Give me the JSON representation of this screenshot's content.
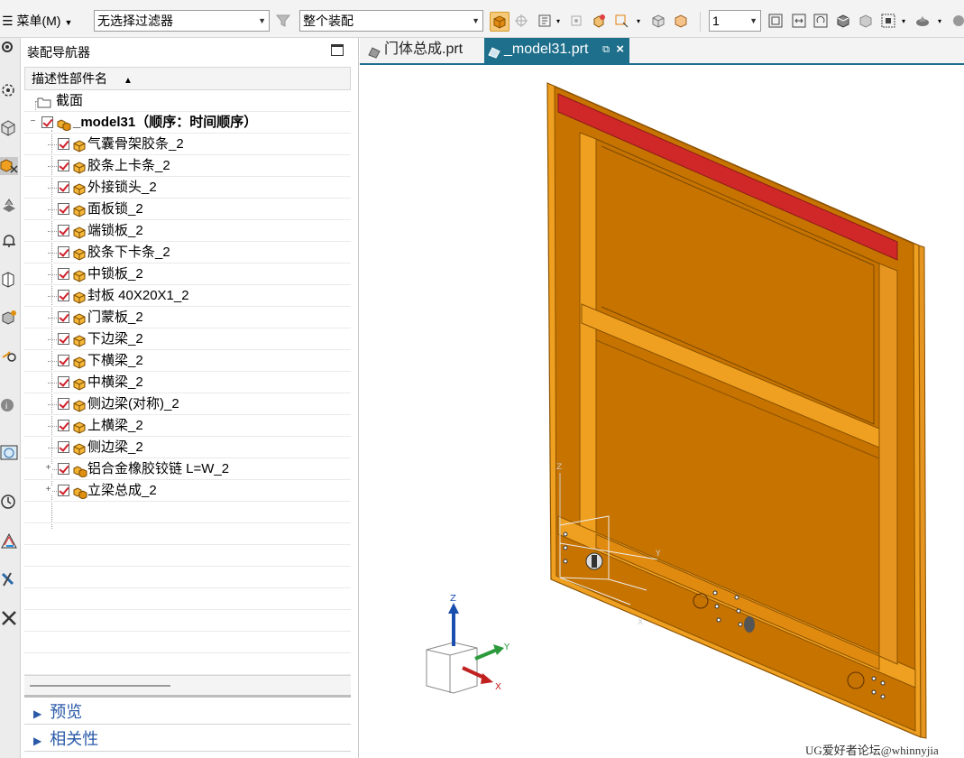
{
  "toolbar": {
    "menu_label": "菜单(M)",
    "filter_value": "无选择过滤器",
    "scope_value": "整个装配",
    "layer_value": "1"
  },
  "navigator": {
    "title": "装配导航器",
    "column_header": "描述性部件名",
    "section_node": "截面",
    "root": {
      "label": "_model31（顺序：时间顺序）"
    },
    "items": [
      {
        "label": "气囊骨架胶条_2",
        "type": "part"
      },
      {
        "label": "胶条上卡条_2",
        "type": "part"
      },
      {
        "label": "外接锁头_2",
        "type": "part"
      },
      {
        "label": "面板锁_2",
        "type": "part"
      },
      {
        "label": "端锁板_2",
        "type": "part"
      },
      {
        "label": "胶条下卡条_2",
        "type": "part"
      },
      {
        "label": "中锁板_2",
        "type": "part"
      },
      {
        "label": "封板 40X20X1_2",
        "type": "part"
      },
      {
        "label": "门蒙板_2",
        "type": "part"
      },
      {
        "label": "下边梁_2",
        "type": "part"
      },
      {
        "label": "下横梁_2",
        "type": "part"
      },
      {
        "label": "中横梁_2",
        "type": "part"
      },
      {
        "label": "侧边梁(对称)_2",
        "type": "part"
      },
      {
        "label": "上横梁_2",
        "type": "part"
      },
      {
        "label": "侧边梁_2",
        "type": "part"
      },
      {
        "label": "铝合金橡胶铰链 L=W_2",
        "type": "assembly"
      },
      {
        "label": "立梁总成_2",
        "type": "assembly"
      }
    ],
    "sections": [
      {
        "label": "预览"
      },
      {
        "label": "相关性"
      }
    ]
  },
  "tabs": [
    {
      "label": "门体总成.prt",
      "active": false
    },
    {
      "label": "_model31.prt",
      "active": true
    }
  ],
  "viewport": {
    "axis_labels": {
      "x": "X",
      "y": "Y",
      "z": "Z"
    },
    "watermark": "UG爱好者论坛@whinnyjia"
  },
  "colors": {
    "model_orange": "#c77300",
    "model_light": "#f0a020",
    "model_red": "#d02828",
    "tab_active": "#1e6f8c"
  }
}
